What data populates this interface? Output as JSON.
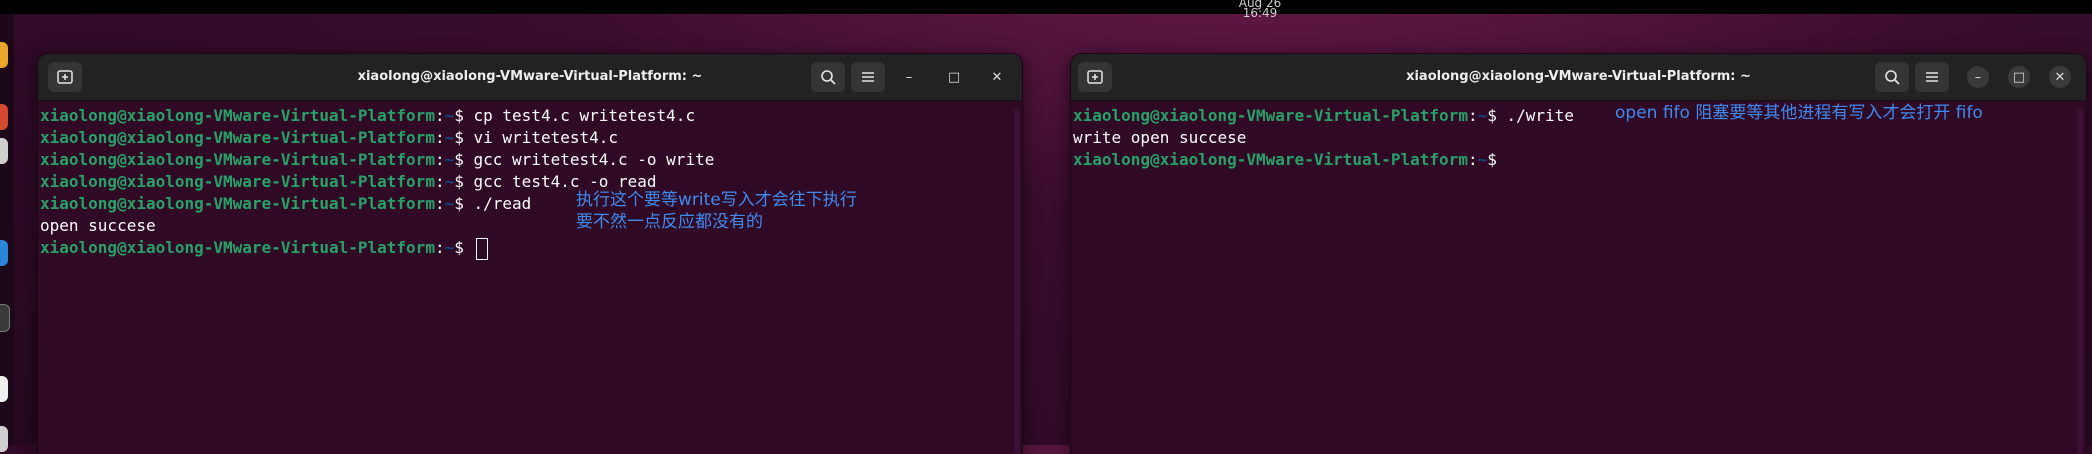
{
  "topbar": {
    "clock": "Aug 26  16:49"
  },
  "colors": {
    "terminal_bg": "#300a24",
    "prompt_user": "#26a269",
    "prompt_path": "#12488b",
    "annotation": "#3d8bf0"
  },
  "prompt": {
    "user": "xiaolong@xiaolong-VMware-Virtual-Platform",
    "colon": ":",
    "path": "~",
    "dollar": "$"
  },
  "left_window": {
    "title": "xiaolong@xiaolong-VMware-Virtual-Platform: ~",
    "lines": [
      {
        "type": "cmd",
        "text": "cp test4.c writetest4.c"
      },
      {
        "type": "cmd",
        "text": "vi writetest4.c"
      },
      {
        "type": "cmd",
        "text": "gcc writetest4.c -o write"
      },
      {
        "type": "cmd",
        "text": "gcc test4.c -o read"
      },
      {
        "type": "cmd",
        "text": "./read"
      },
      {
        "type": "out",
        "text": "open succese"
      },
      {
        "type": "cmd",
        "text": ""
      }
    ],
    "note_line1": "执行这个要等write写入才会往下执行",
    "note_line2": "要不然一点反应都没有的"
  },
  "right_window": {
    "title": "xiaolong@xiaolong-VMware-Virtual-Platform: ~",
    "lines": [
      {
        "type": "cmd",
        "text": "./write"
      },
      {
        "type": "out",
        "text": "write open succese"
      },
      {
        "type": "cmd",
        "text": ""
      }
    ],
    "note": "open  fifo 阻塞要等其他进程有写入才会打开 fifo"
  },
  "icons": {
    "new_tab": "new-tab-icon",
    "search": "search-icon",
    "menu": "hamburger-menu-icon",
    "minimize": "minimize-icon",
    "maximize": "maximize-icon",
    "close": "close-icon"
  }
}
